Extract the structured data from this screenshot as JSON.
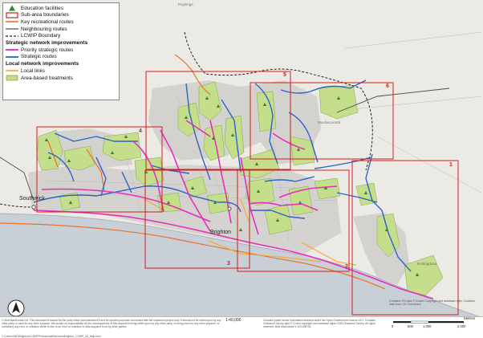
{
  "legend": {
    "items": [
      {
        "label": "Education facilities",
        "symbol": "triangle",
        "color": "#2e8b2e"
      },
      {
        "label": "Sub-area boundaries",
        "symbol": "box",
        "color": "#cc2020"
      },
      {
        "label": "Key recreational routes",
        "symbol": "line",
        "color": "#e8722a"
      },
      {
        "label": "Neighbouring routes",
        "symbol": "line",
        "color": "#4a4a4a"
      },
      {
        "label": "LCWIP Boundary",
        "symbol": "dashed",
        "color": "#222222"
      }
    ],
    "strategic_heading": "Strategic network improvements",
    "strategic_items": [
      {
        "label": "Priority strategic routes",
        "symbol": "line",
        "color": "#e62ebd"
      },
      {
        "label": "Strategic routes",
        "symbol": "line",
        "color": "#2f62c8"
      }
    ],
    "local_heading": "Local network improvements",
    "local_items": [
      {
        "label": "Local links",
        "symbol": "line",
        "color": "#f5a623"
      },
      {
        "label": "Area-based treatments",
        "symbol": "box",
        "color": "#c5de8c"
      }
    ]
  },
  "sub_areas": [
    {
      "id": "sub-area-1",
      "label": "1"
    },
    {
      "id": "sub-area-2",
      "label": "2"
    },
    {
      "id": "sub-area-3",
      "label": "3"
    },
    {
      "id": "sub-area-4",
      "label": "4"
    },
    {
      "id": "sub-area-5",
      "label": "5"
    },
    {
      "id": "sub-area-6",
      "label": "6"
    }
  ],
  "places": {
    "southwick": "Southwick",
    "brighton": "Brighton",
    "poynings": "Poynings",
    "rottingdean": "Rottingdean",
    "moulsecoomb": "Moulsecoomb"
  },
  "footer": {
    "scale": "1:40,000",
    "note_left": "© Mott MacDonald Ltd. This document is issued for the party which commissioned it and for specific purposes connected with the captioned project only. It should not be relied upon by any other party or used for any other purpose. We accept no responsibility for the consequences of this document being relied upon by any other party, or being used for any other purpose, or containing any error or omission which is due to an error or omission in data supplied to us by other parties.",
    "path": "C:\\Users\\CBE\\Brighton\\LCWIP\\ProfessionalServices\\Brighton_LCWIP_A3_Map.mxd",
    "note_right": "Contains public sector information licensed under the Open Government Licence v3.0. Contains Ordnance Survey data © Crown copyright and database rights 2019 Ordnance Survey. All rights reserved. Mott MacDonald 1:100:036751",
    "copyright": "Contains OS data © Crown Copyright and database right. Contains data from OS Zoomstack",
    "scale_unit": "Metres",
    "scale_ticks": [
      "0",
      "500",
      "1,000",
      "2,000"
    ]
  },
  "colors": {
    "sea": "#c9cfd6",
    "land": "#eceae4",
    "urban": "#d2d0cc",
    "green": "#c5de8c",
    "priority": "#e62ebd",
    "strategic": "#2f62c8",
    "local": "#f5a623",
    "recreational": "#e8722a",
    "subarea": "#cc2020",
    "education": "#2e8b2e"
  },
  "north_icon": "north-arrow"
}
